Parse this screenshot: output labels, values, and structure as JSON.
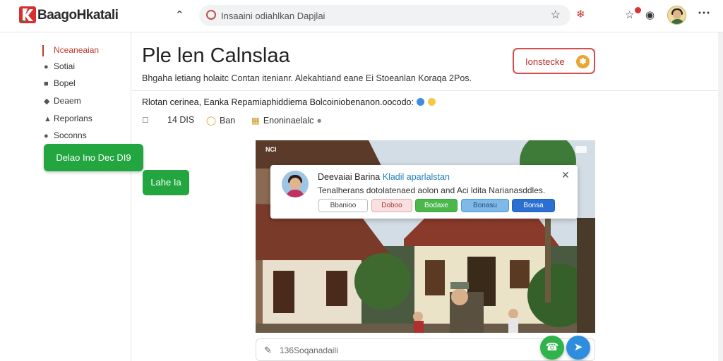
{
  "header": {
    "brand": "BaagoHkatali",
    "collapse_icon": "chevron-up-icon",
    "search_text": "Insaaini odiahlkan Dapjlai",
    "icons": [
      "star-icon",
      "extension-icon",
      "notification-icon",
      "settings-icon",
      "avatar",
      "more-icon"
    ]
  },
  "sidebar": {
    "items": [
      {
        "label": "Nceaneaian",
        "icon": "bookmark-icon"
      },
      {
        "label": "Sotiai",
        "icon": "user-icon"
      },
      {
        "label": "Bopel",
        "icon": "square-icon"
      },
      {
        "label": "Deaem",
        "icon": "tag-icon"
      },
      {
        "label": "Reporlans",
        "icon": "home-icon"
      },
      {
        "label": "Soconns",
        "icon": "people-icon"
      }
    ],
    "primary_button": "Delao Ino Dec DI9",
    "secondary_button": "Lahe Ia"
  },
  "main": {
    "title": "Ple len Calnslaa",
    "subtitle": "Bhgaha letiang holaitc  Contan itenianr. Alekahtiand eane Ei Stoeanlan Koraqa 2Pos.",
    "action_button": "Ionstecke",
    "description": "Rlotan cerinea, Eanka Repamiaphiddiema Bolcoiniobenanon.oocodo:",
    "meta": [
      {
        "icon": "share-icon",
        "label": ""
      },
      {
        "icon": "",
        "label": "14 DIS"
      },
      {
        "icon": "comment-icon",
        "label": "Ban"
      },
      {
        "icon": "folder-icon",
        "label": "Enoninaelalc"
      }
    ],
    "photo_tag": "NCI"
  },
  "popup": {
    "name": "Deevaiai Barina",
    "name_highlight": "Kladil aparlalstan",
    "message": "Tenalherans dotolatenaed aolon and Aci ldita Narianasddles.",
    "buttons": [
      "Bbanioo",
      "Doboo",
      "Bodaxe",
      "Bonasu",
      "Bonsa"
    ]
  },
  "comment_bar": {
    "placeholder": "136Soqanadaili"
  },
  "colors": {
    "accent_red": "#c0392b",
    "primary_green": "#23a640",
    "link_blue": "#1f7fc0"
  }
}
